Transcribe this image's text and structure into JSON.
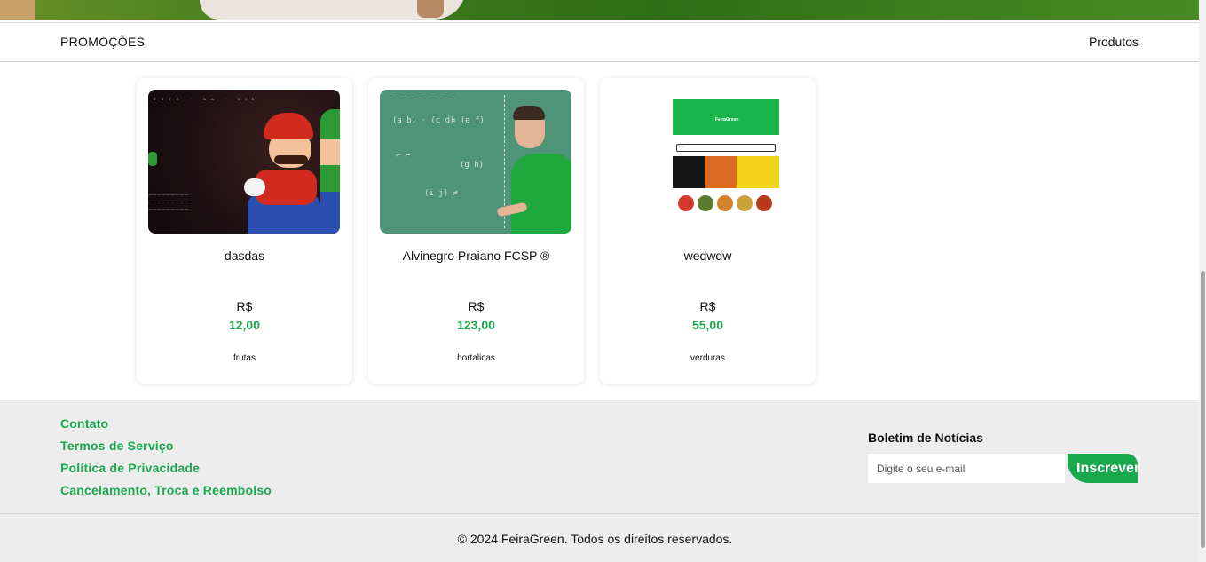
{
  "header": {
    "left_label": "PROMOÇÕES",
    "right_label": "Produtos"
  },
  "products": [
    {
      "name": "dasdas",
      "currency": "R$",
      "price": "12,00",
      "category": "frutas",
      "image": "mario-movie-banner-image"
    },
    {
      "name": "Alvinegro Praiano FCSP ®",
      "currency": "R$",
      "price": "123,00",
      "category": "hortalicas",
      "image": "teacher-at-chalkboard-image"
    },
    {
      "name": "wedwdw",
      "currency": "R$",
      "price": "55,00",
      "category": "verduras",
      "image": "feiragreen-app-mockup-image"
    }
  ],
  "footer": {
    "links": [
      "Contato",
      "Termos de Serviço",
      "Política de Privacidade",
      "Cancelamento, Troca e Reembolso"
    ],
    "newsletter": {
      "title": "Boletim de Notícias",
      "placeholder": "Digite o seu e-mail",
      "button": "Inscrever"
    },
    "copyright": "© 2024 FeiraGreen. Todos os direitos reservados."
  },
  "colors": {
    "accent": "#1aa84c",
    "footer_bg": "#ededed"
  }
}
